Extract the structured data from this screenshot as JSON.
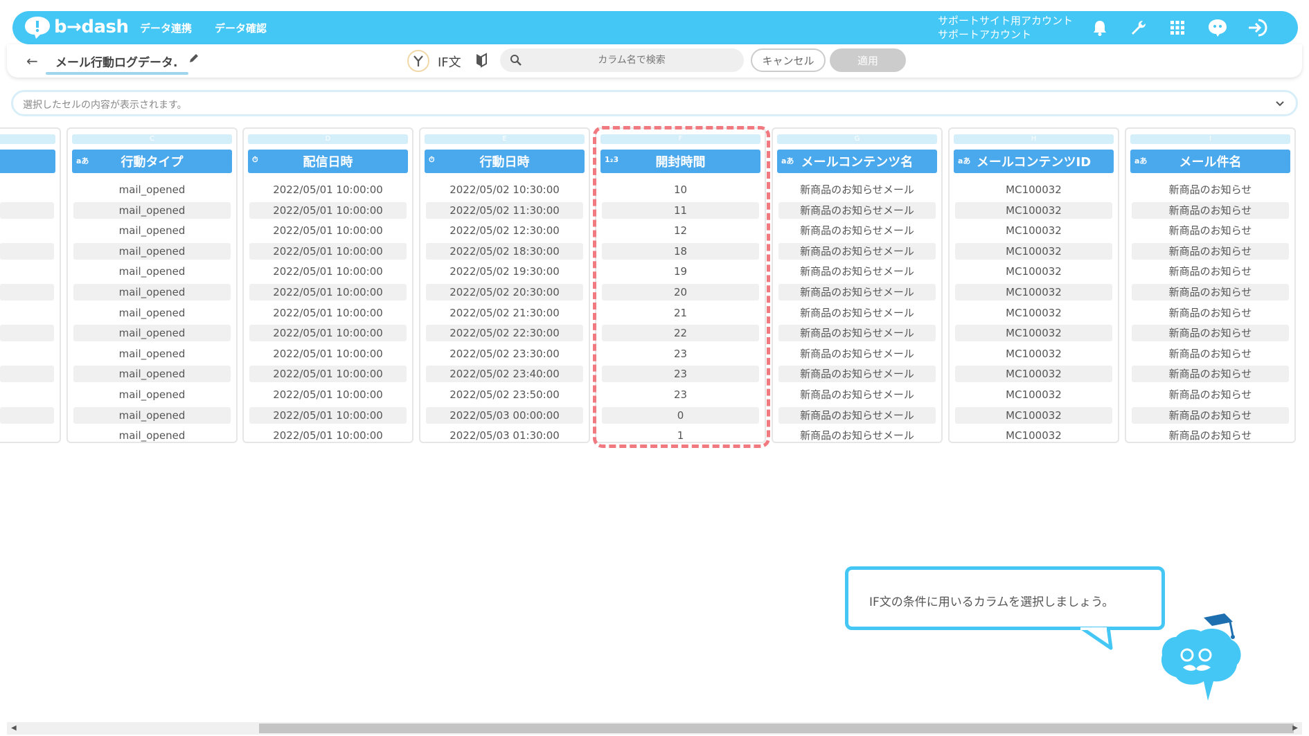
{
  "header": {
    "logo_text": "b→dash",
    "nav": [
      "データ連携",
      "データ確認"
    ],
    "account_line1": "サポートサイト用アカウント",
    "account_line2": "サポートアカウント"
  },
  "subbar": {
    "back_icon": "←",
    "title": "メール行動ログデータ.",
    "if_label": "IF文",
    "search_placeholder": "カラム名で検索",
    "cancel_label": "キャンセル",
    "apply_label": "適用"
  },
  "cellbar": {
    "text": "選択したセルの内容が表示されます。"
  },
  "columns": [
    {
      "letter": "C",
      "type": "aあ",
      "name": "行動タイプ"
    },
    {
      "letter": "D",
      "type": "⏱",
      "name": "配信日時"
    },
    {
      "letter": "E",
      "type": "⏱",
      "name": "行動日時"
    },
    {
      "letter": "F",
      "type": "1₂3",
      "name": "開封時間"
    },
    {
      "letter": "G",
      "type": "aあ",
      "name": "メールコンテンツ名"
    },
    {
      "letter": "H",
      "type": "aあ",
      "name": "メールコンテンツID"
    },
    {
      "letter": "I",
      "type": "aあ",
      "name": "メール件名"
    }
  ],
  "rows": [
    [
      "mail_opened",
      "2022/05/01 10:00:00",
      "2022/05/02 10:30:00",
      "10",
      "新商品のお知らせメール",
      "MC100032",
      "新商品のお知らせ"
    ],
    [
      "mail_opened",
      "2022/05/01 10:00:00",
      "2022/05/02 11:30:00",
      "11",
      "新商品のお知らせメール",
      "MC100032",
      "新商品のお知らせ"
    ],
    [
      "mail_opened",
      "2022/05/01 10:00:00",
      "2022/05/02 12:30:00",
      "12",
      "新商品のお知らせメール",
      "MC100032",
      "新商品のお知らせ"
    ],
    [
      "mail_opened",
      "2022/05/01 10:00:00",
      "2022/05/02 18:30:00",
      "18",
      "新商品のお知らせメール",
      "MC100032",
      "新商品のお知らせ"
    ],
    [
      "mail_opened",
      "2022/05/01 10:00:00",
      "2022/05/02 19:30:00",
      "19",
      "新商品のお知らせメール",
      "MC100032",
      "新商品のお知らせ"
    ],
    [
      "mail_opened",
      "2022/05/01 10:00:00",
      "2022/05/02 20:30:00",
      "20",
      "新商品のお知らせメール",
      "MC100032",
      "新商品のお知らせ"
    ],
    [
      "mail_opened",
      "2022/05/01 10:00:00",
      "2022/05/02 21:30:00",
      "21",
      "新商品のお知らせメール",
      "MC100032",
      "新商品のお知らせ"
    ],
    [
      "mail_opened",
      "2022/05/01 10:00:00",
      "2022/05/02 22:30:00",
      "22",
      "新商品のお知らせメール",
      "MC100032",
      "新商品のお知らせ"
    ],
    [
      "mail_opened",
      "2022/05/01 10:00:00",
      "2022/05/02 23:30:00",
      "23",
      "新商品のお知らせメール",
      "MC100032",
      "新商品のお知らせ"
    ],
    [
      "mail_opened",
      "2022/05/01 10:00:00",
      "2022/05/02 23:40:00",
      "23",
      "新商品のお知らせメール",
      "MC100032",
      "新商品のお知らせ"
    ],
    [
      "mail_opened",
      "2022/05/01 10:00:00",
      "2022/05/02 23:50:00",
      "23",
      "新商品のお知らせメール",
      "MC100032",
      "新商品のお知らせ"
    ],
    [
      "mail_opened",
      "2022/05/01 10:00:00",
      "2022/05/03 00:00:00",
      "0",
      "新商品のお知らせメール",
      "MC100032",
      "新商品のお知らせ"
    ],
    [
      "mail_opened",
      "2022/05/01 10:00:00",
      "2022/05/03 01:30:00",
      "1",
      "新商品のお知らせメール",
      "MC100032",
      "新商品のお知らせ"
    ]
  ],
  "tooltip": {
    "text": "IF文の条件に用いるカラムを選択しましょう。"
  },
  "colors": {
    "brand": "#45c7f5",
    "column_header": "#4aa8ec",
    "highlight": "#f07a80"
  }
}
